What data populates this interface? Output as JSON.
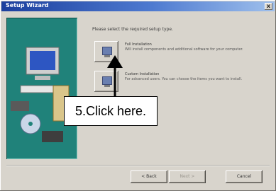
{
  "window": {
    "title": "Setup Wizard",
    "close_label": "x",
    "heading": "Please select the required setup type."
  },
  "options": [
    {
      "title": "Full Installation",
      "description": "Will install components and additional software for your computer."
    },
    {
      "title": "Custom Installation",
      "description": "For advanced users. You can choose the items you want to install."
    }
  ],
  "footer": {
    "back_label": "< Back",
    "next_label": "Next >",
    "cancel_label": "Cancel"
  },
  "callout": {
    "text": "5.Click here."
  },
  "colors": {
    "title_bar": "#1c3f9e",
    "side_panel": "#20827a",
    "window_face": "#d8d4cc"
  }
}
